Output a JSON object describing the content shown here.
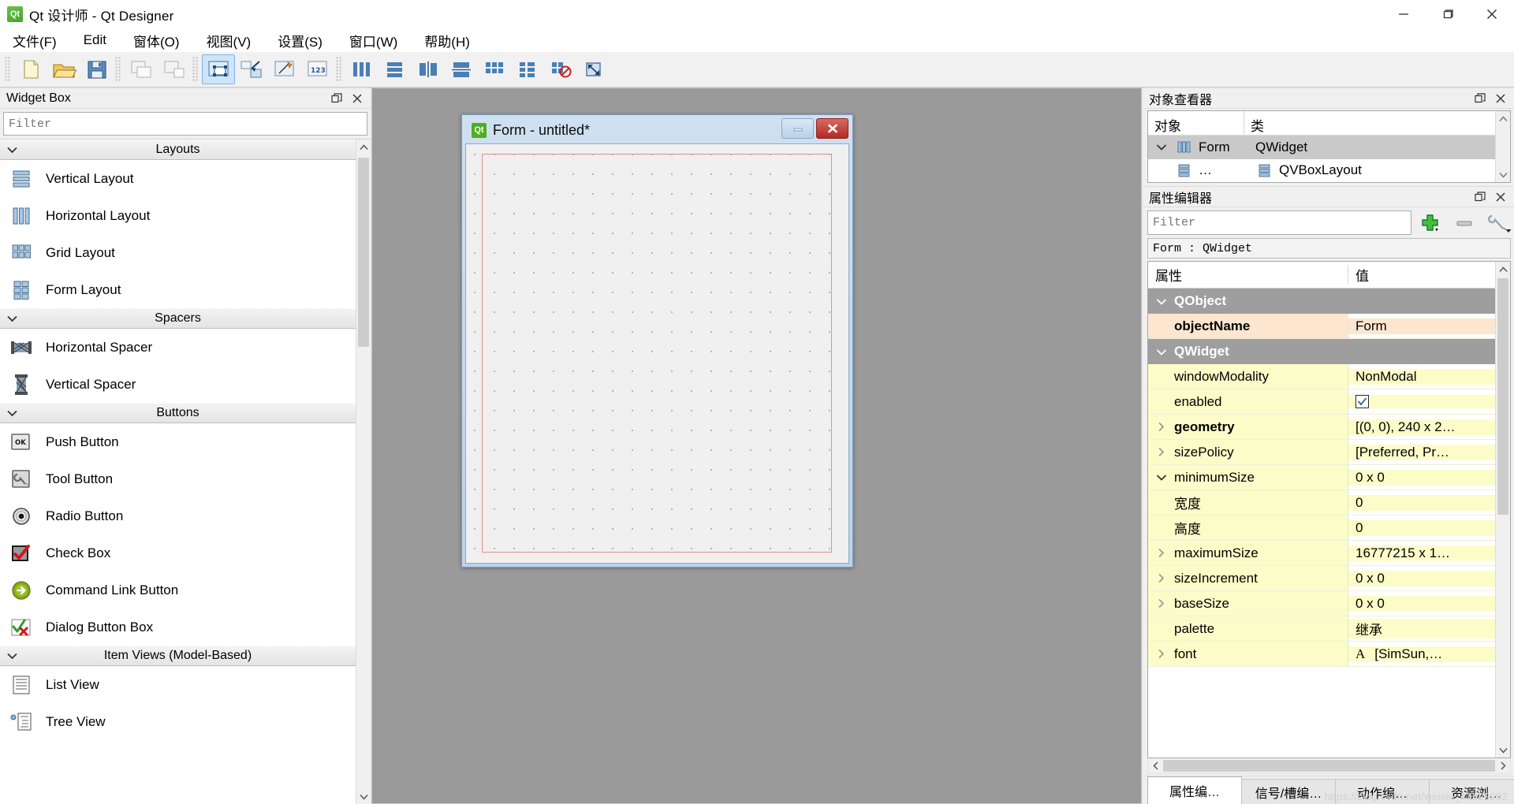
{
  "window": {
    "title": "Qt 设计师 - Qt Designer",
    "app_icon": "qt-logo-icon",
    "minimize_label": "最小化",
    "maximize_label": "最大化",
    "close_label": "关闭"
  },
  "menubar": {
    "items": [
      {
        "label": "文件(F)",
        "accel": "F"
      },
      {
        "label": "Edit",
        "accel": "E"
      },
      {
        "label": "窗体(O)",
        "accel": "O"
      },
      {
        "label": "视图(V)",
        "accel": "V"
      },
      {
        "label": "设置(S)",
        "accel": "S"
      },
      {
        "label": "窗口(W)",
        "accel": "W"
      },
      {
        "label": "帮助(H)",
        "accel": "H"
      }
    ]
  },
  "toolbar": {
    "groups": [
      {
        "name": "file",
        "buttons": [
          {
            "name": "new-form-button",
            "icon": "new-document-icon",
            "active": false
          },
          {
            "name": "open-form-button",
            "icon": "open-folder-icon",
            "active": false
          },
          {
            "name": "save-form-button",
            "icon": "floppy-disk-icon",
            "active": false
          }
        ]
      },
      {
        "name": "edit",
        "buttons": [
          {
            "name": "undo-button",
            "icon": "undo-stack-icon",
            "active": false
          },
          {
            "name": "redo-button",
            "icon": "redo-stack-icon",
            "active": false
          }
        ]
      },
      {
        "name": "mode",
        "buttons": [
          {
            "name": "edit-widgets-button",
            "icon": "edit-widgets-icon",
            "active": true
          },
          {
            "name": "edit-signals-slots-button",
            "icon": "signal-slot-icon",
            "active": false
          },
          {
            "name": "edit-buddies-button",
            "icon": "buddy-pencil-icon",
            "active": false
          },
          {
            "name": "edit-tab-order-button",
            "icon": "tab-order-123-icon",
            "active": false
          }
        ]
      },
      {
        "name": "layout",
        "buttons": [
          {
            "name": "layout-horizontally-button",
            "icon": "layout-horizontal-icon",
            "active": false
          },
          {
            "name": "layout-vertically-button",
            "icon": "layout-vertical-icon",
            "active": false
          },
          {
            "name": "layout-splitter-horizontal-button",
            "icon": "splitter-horizontal-icon",
            "active": false
          },
          {
            "name": "layout-splitter-vertical-button",
            "icon": "splitter-vertical-icon",
            "active": false
          },
          {
            "name": "layout-grid-button",
            "icon": "layout-grid-icon",
            "active": false
          },
          {
            "name": "layout-form-button",
            "icon": "layout-form-icon",
            "active": false
          },
          {
            "name": "break-layout-button",
            "icon": "break-layout-icon",
            "active": false
          },
          {
            "name": "adjust-size-button",
            "icon": "adjust-size-icon",
            "active": false
          }
        ]
      }
    ]
  },
  "widget_box": {
    "title": "Widget Box",
    "float_label": "浮动",
    "close_label": "关闭",
    "filter": {
      "value": "",
      "placeholder": "Filter"
    },
    "categories": [
      {
        "name": "Layouts",
        "expanded": true,
        "items": [
          {
            "label": "Vertical Layout",
            "icon": "vertical-layout-icon"
          },
          {
            "label": "Horizontal Layout",
            "icon": "horizontal-layout-icon"
          },
          {
            "label": "Grid Layout",
            "icon": "grid-layout-icon"
          },
          {
            "label": "Form Layout",
            "icon": "form-layout-icon"
          }
        ]
      },
      {
        "name": "Spacers",
        "expanded": true,
        "items": [
          {
            "label": "Horizontal Spacer",
            "icon": "horizontal-spacer-icon"
          },
          {
            "label": "Vertical Spacer",
            "icon": "vertical-spacer-icon"
          }
        ]
      },
      {
        "name": "Buttons",
        "expanded": true,
        "items": [
          {
            "label": "Push Button",
            "icon": "push-button-icon"
          },
          {
            "label": "Tool Button",
            "icon": "tool-button-icon"
          },
          {
            "label": "Radio Button",
            "icon": "radio-button-icon"
          },
          {
            "label": "Check Box",
            "icon": "check-box-icon"
          },
          {
            "label": "Command Link Button",
            "icon": "command-link-icon"
          },
          {
            "label": "Dialog Button Box",
            "icon": "dialog-button-box-icon"
          }
        ]
      },
      {
        "name": "Item Views (Model-Based)",
        "expanded": true,
        "items": [
          {
            "label": "List View",
            "icon": "list-view-icon"
          },
          {
            "label": "Tree View",
            "icon": "tree-view-icon"
          }
        ]
      }
    ]
  },
  "form_window": {
    "title": "Form - untitled*",
    "icon": "qt-logo-icon",
    "modified": true,
    "minimize_label": "最小化",
    "close_label": "关闭"
  },
  "object_inspector": {
    "title": "对象查看器",
    "float_label": "浮动",
    "close_label": "关闭",
    "columns": [
      "对象",
      "类"
    ],
    "rows": [
      {
        "name": "Form",
        "class": "QWidget",
        "icon": "horizontal-layout-icon",
        "level": 0,
        "expanded": true,
        "selected": true
      },
      {
        "name": "…",
        "class": "QVBoxLayout",
        "icon": "vertical-layout-icon",
        "level": 1,
        "expanded": false,
        "selected": false
      }
    ]
  },
  "property_editor": {
    "title": "属性编辑器",
    "float_label": "浮动",
    "close_label": "关闭",
    "filter": {
      "value": "",
      "placeholder": "Filter"
    },
    "add_button_label": "添加",
    "remove_button_label": "移除",
    "configure_button_label": "配置",
    "object_line": "Form : QWidget",
    "columns": [
      "属性",
      "值"
    ],
    "rows": [
      {
        "kind": "group",
        "name": "QObject",
        "value": "",
        "expanded": true
      },
      {
        "kind": "prop",
        "name": "objectName",
        "value": "Form",
        "bold": true,
        "tint": "peach",
        "indent": 1,
        "chev": ""
      },
      {
        "kind": "group",
        "name": "QWidget",
        "value": "",
        "expanded": true
      },
      {
        "kind": "prop",
        "name": "windowModality",
        "value": "NonModal",
        "bold": false,
        "tint": "yellow",
        "indent": 1,
        "chev": ""
      },
      {
        "kind": "prop",
        "name": "enabled",
        "value": "",
        "checkbox": true,
        "bold": false,
        "tint": "yellow",
        "indent": 1,
        "chev": ""
      },
      {
        "kind": "prop",
        "name": "geometry",
        "value": "[(0, 0), 240 x 2…",
        "bold": true,
        "tint": "yellow",
        "indent": 0,
        "chev": "right"
      },
      {
        "kind": "prop",
        "name": "sizePolicy",
        "value": "[Preferred, Pr…",
        "bold": false,
        "tint": "yellow",
        "indent": 0,
        "chev": "right"
      },
      {
        "kind": "prop",
        "name": "minimumSize",
        "value": "0 x 0",
        "bold": false,
        "tint": "yellow",
        "indent": 0,
        "chev": "down"
      },
      {
        "kind": "prop",
        "name": "宽度",
        "value": "0",
        "bold": false,
        "tint": "yellow",
        "indent": 2,
        "chev": ""
      },
      {
        "kind": "prop",
        "name": "高度",
        "value": "0",
        "bold": false,
        "tint": "yellow",
        "indent": 2,
        "chev": ""
      },
      {
        "kind": "prop",
        "name": "maximumSize",
        "value": "16777215 x 1…",
        "bold": false,
        "tint": "yellow",
        "indent": 0,
        "chev": "right"
      },
      {
        "kind": "prop",
        "name": "sizeIncrement",
        "value": "0 x 0",
        "bold": false,
        "tint": "yellow",
        "indent": 0,
        "chev": "right"
      },
      {
        "kind": "prop",
        "name": "baseSize",
        "value": "0 x 0",
        "bold": false,
        "tint": "yellow",
        "indent": 0,
        "chev": "right"
      },
      {
        "kind": "prop",
        "name": "palette",
        "value": "继承",
        "bold": false,
        "tint": "yellow",
        "indent": 1,
        "chev": ""
      },
      {
        "kind": "prop",
        "name": "font",
        "value": "[SimSun,…",
        "font_icon": true,
        "bold": false,
        "tint": "yellow",
        "indent": 0,
        "chev": "right"
      }
    ],
    "tabs": [
      {
        "label": "属性编…",
        "active": true
      },
      {
        "label": "信号/槽编…",
        "active": false
      },
      {
        "label": "动作编…",
        "active": false
      },
      {
        "label": "资源浏…",
        "active": false
      }
    ]
  },
  "watermark": "https://blog.csdn.net/weixin_43829992"
}
